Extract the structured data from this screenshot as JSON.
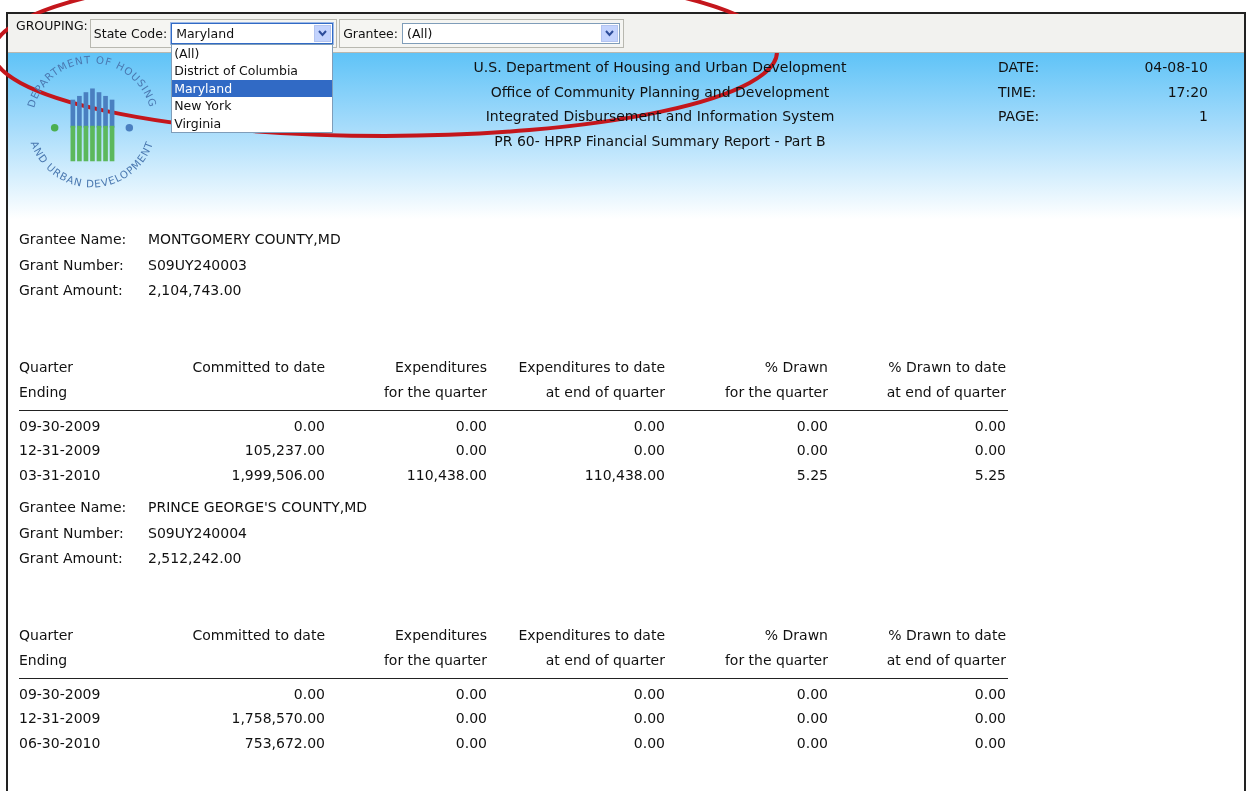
{
  "toolbar": {
    "label": "GROUPING:",
    "filters": [
      {
        "label": "State Code:",
        "value": "Maryland",
        "expanded": true,
        "options": [
          {
            "label": "(All)",
            "selected": false
          },
          {
            "label": "District of Columbia",
            "selected": false
          },
          {
            "label": "Maryland",
            "selected": true
          },
          {
            "label": "New York",
            "selected": false
          },
          {
            "label": "Virginia",
            "selected": false
          }
        ]
      },
      {
        "label": "Grantee:",
        "value": "(All)",
        "expanded": false
      }
    ]
  },
  "header": {
    "seal_text_top": "DEPARTMENT OF HOUSING",
    "seal_text_bottom": "AND URBAN DEVELOPMENT",
    "titles": [
      "U.S. Department of Housing and Urban Development",
      "Office of Community Planning and Development",
      "Integrated Disbursement and Information System",
      "PR 60-  HPRP Financial Summary Report - Part B"
    ],
    "meta": [
      {
        "label": "DATE:",
        "value": "04-08-10"
      },
      {
        "label": "TIME:",
        "value": "17:20"
      },
      {
        "label": "PAGE:",
        "value": "1"
      }
    ]
  },
  "grantees": [
    {
      "info": [
        {
          "label": "Grantee Name:",
          "value": "MONTGOMERY COUNTY,MD"
        },
        {
          "label": "Grant Number:",
          "value": "S09UY240003"
        },
        {
          "label": "Grant Amount:",
          "value": "2,104,743.00"
        }
      ],
      "header_rows": [
        [
          "Quarter",
          "Committed to date",
          "Expenditures",
          "Expenditures to date",
          "% Drawn",
          "% Drawn to date"
        ],
        [
          "Ending",
          null,
          "for the quarter",
          "at end of quarter",
          "for the quarter",
          "at end of quarter"
        ]
      ],
      "rows": [
        [
          "09-30-2009",
          "0.00",
          "0.00",
          "0.00",
          "0.00",
          "0.00"
        ],
        [
          "12-31-2009",
          "105,237.00",
          "0.00",
          "0.00",
          "0.00",
          "0.00"
        ],
        [
          "03-31-2010",
          "1,999,506.00",
          "110,438.00",
          "110,438.00",
          "5.25",
          "5.25"
        ]
      ]
    },
    {
      "info": [
        {
          "label": "Grantee Name:",
          "value": "PRINCE GEORGE'S COUNTY,MD"
        },
        {
          "label": "Grant Number:",
          "value": "S09UY240004"
        },
        {
          "label": "Grant Amount:",
          "value": "2,512,242.00"
        }
      ],
      "header_rows": [
        [
          "Quarter",
          "Committed to date",
          "Expenditures",
          "Expenditures to date",
          "% Drawn",
          "% Drawn to date"
        ],
        [
          "Ending",
          null,
          "for the quarter",
          "at end of quarter",
          "for the quarter",
          "at end of quarter"
        ]
      ],
      "rows": [
        [
          "09-30-2009",
          "0.00",
          "0.00",
          "0.00",
          "0.00",
          "0.00"
        ],
        [
          "12-31-2009",
          "1,758,570.00",
          "0.00",
          "0.00",
          "0.00",
          "0.00"
        ],
        [
          "06-30-2010",
          "753,672.00",
          "0.00",
          "0.00",
          "0.00",
          "0.00"
        ]
      ]
    }
  ]
}
